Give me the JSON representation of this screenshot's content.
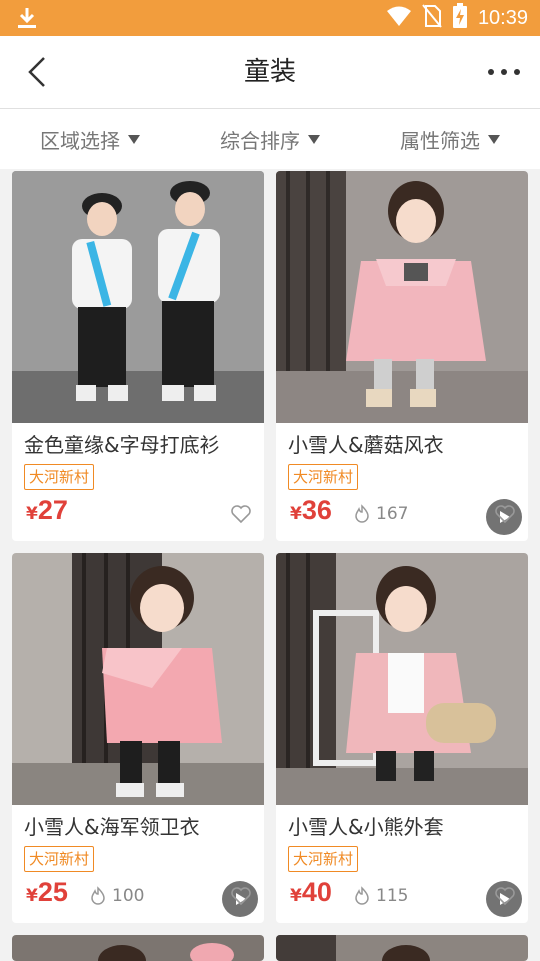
{
  "status_bar": {
    "time": "10:39"
  },
  "header": {
    "title": "童装"
  },
  "filters": [
    "区域选择",
    "综合排序",
    "属性筛选"
  ],
  "colors": {
    "accent": "#f29d3d",
    "price": "#e0413a",
    "tag": "#f08a24"
  },
  "products": [
    {
      "name": "金色童缘&字母打底衫",
      "tag": "大河新村",
      "currency": "¥",
      "price": "27",
      "likes": "",
      "has_video": false
    },
    {
      "name": "小雪人&蘑菇风衣",
      "tag": "大河新村",
      "currency": "¥",
      "price": "36",
      "likes": "167",
      "has_video": true
    },
    {
      "name": "小雪人&海军领卫衣",
      "tag": "大河新村",
      "currency": "¥",
      "price": "25",
      "likes": "100",
      "has_video": true
    },
    {
      "name": "小雪人&小熊外套",
      "tag": "大河新村",
      "currency": "¥",
      "price": "40",
      "likes": "115",
      "has_video": true
    }
  ]
}
